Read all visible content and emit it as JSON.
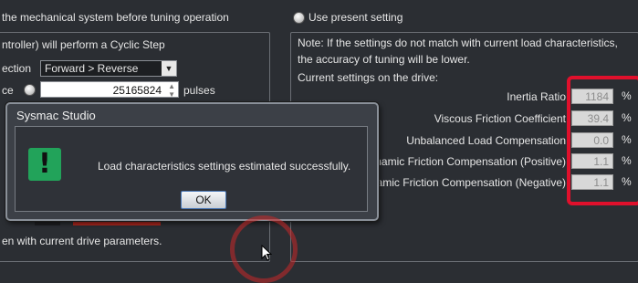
{
  "top": {
    "left_heading": "the mechanical system before tuning operation",
    "right_option": "Use present setting"
  },
  "left": {
    "cyclic_text": "ntroller) will perform a Cyclic Step",
    "direction_label": "ection",
    "direction_value": "Forward > Reverse",
    "distance_label": "ce",
    "distance_value": "25165824",
    "distance_unit": "pulses",
    "footer_text": "en with current drive parameters."
  },
  "right": {
    "note": "Note: If the settings do not match with current load characteristics,",
    "note2": "the accuracy of tuning will be lower.",
    "current_label": "Current settings on the drive:",
    "params": [
      {
        "label": "Inertia Ratio",
        "value": "1184",
        "unit": "%"
      },
      {
        "label": "Viscous Friction Coefficient",
        "value": "39.4",
        "unit": "%"
      },
      {
        "label": "Unbalanced Load Compensation",
        "value": "0.0",
        "unit": "%"
      },
      {
        "label": "namic Friction Compensation (Positive)",
        "value": "1.1",
        "unit": "%"
      },
      {
        "label": "amic Friction Compensation (Negative)",
        "value": "1.1",
        "unit": "%"
      }
    ]
  },
  "dialog": {
    "title": "Sysmac Studio",
    "message": "Load characteristics settings estimated successfully.",
    "ok_label": "OK",
    "icon": "exclamation-icon"
  },
  "colors": {
    "background": "#2b2e33",
    "highlight": "#e0102c",
    "dialog_icon": "#22a35a"
  }
}
